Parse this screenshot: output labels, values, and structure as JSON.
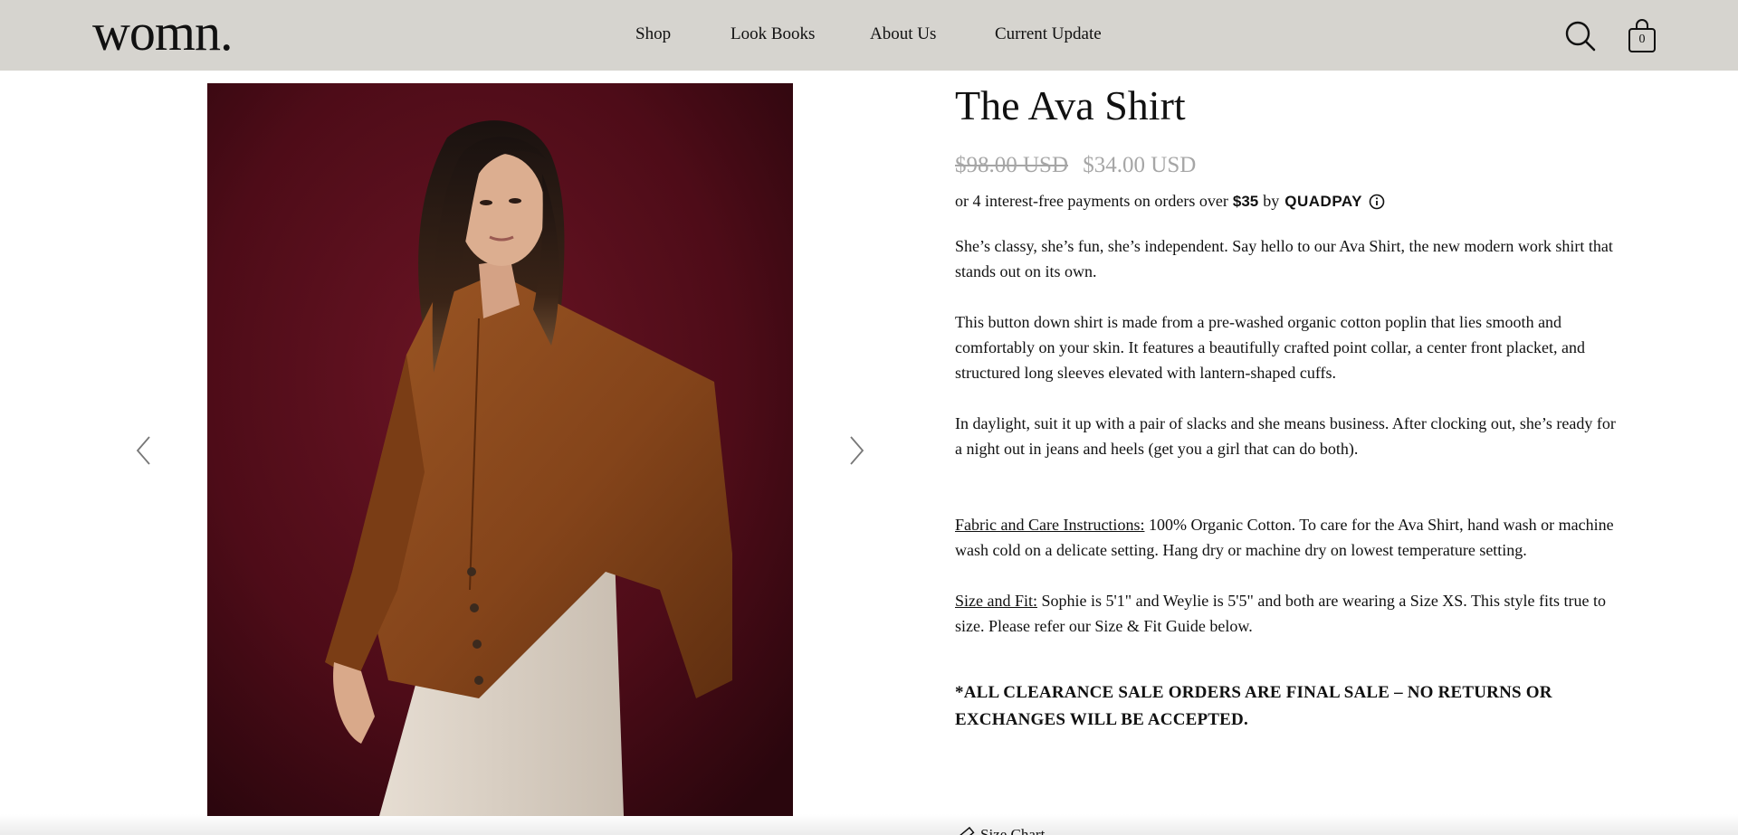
{
  "header": {
    "logo": "womn.",
    "nav": [
      "Shop",
      "Look Books",
      "About Us",
      "Current Update"
    ],
    "cart_count": "0"
  },
  "product": {
    "title": "The Ava Shirt",
    "price_original": "$98.00 USD",
    "price_sale": "$34.00 USD",
    "quadpay": {
      "text": "or 4 interest-free payments on orders over",
      "amount": "$35",
      "by": "by",
      "brand": "QUADPAY"
    },
    "description": [
      "She’s classy, she’s fun, she’s independent. Say hello to our Ava Shirt, the new modern work shirt that stands out on its own.",
      "This button down shirt is made from a pre-washed organic cotton poplin that lies smooth and comfortably on your skin. It features a beautifully crafted point collar, a center front placket, and structured long sleeves elevated with lantern-shaped cuffs.",
      "In daylight, suit it up with a pair of slacks and she means business. After clocking out, she’s ready for a night out in jeans and heels (get you a girl that can do both)."
    ],
    "fabric_label": "Fabric and Care Instructions:",
    "fabric_text": " 100% Organic Cotton. To care for the Ava Shirt, hand wash or machine wash cold on a delicate setting. Hang dry or machine dry on lowest temperature setting.",
    "size_label": "Size and Fit:",
    "size_text": " Sophie is 5'1\" and Weylie is 5'5\" and both are wearing a Size XS. This style fits true to size. Please refer our Size & Fit Guide below.",
    "final_sale": "*ALL CLEARANCE SALE ORDERS ARE FINAL SALE – NO RETURNS OR EXCHANGES WILL BE ACCEPTED.",
    "size_chart": "Size Chart"
  },
  "icons": {
    "search": "search-icon",
    "cart": "shopping-bag-icon",
    "prev": "chevron-left-icon",
    "next": "chevron-right-icon",
    "info": "info-circle-icon",
    "ruler": "ruler-icon"
  },
  "colors": {
    "header_bg": "#d6d4cf",
    "photo_bg": "#5a0f1c",
    "shirt": "#8a4a1c",
    "price_grey": "#a6a6a6"
  }
}
